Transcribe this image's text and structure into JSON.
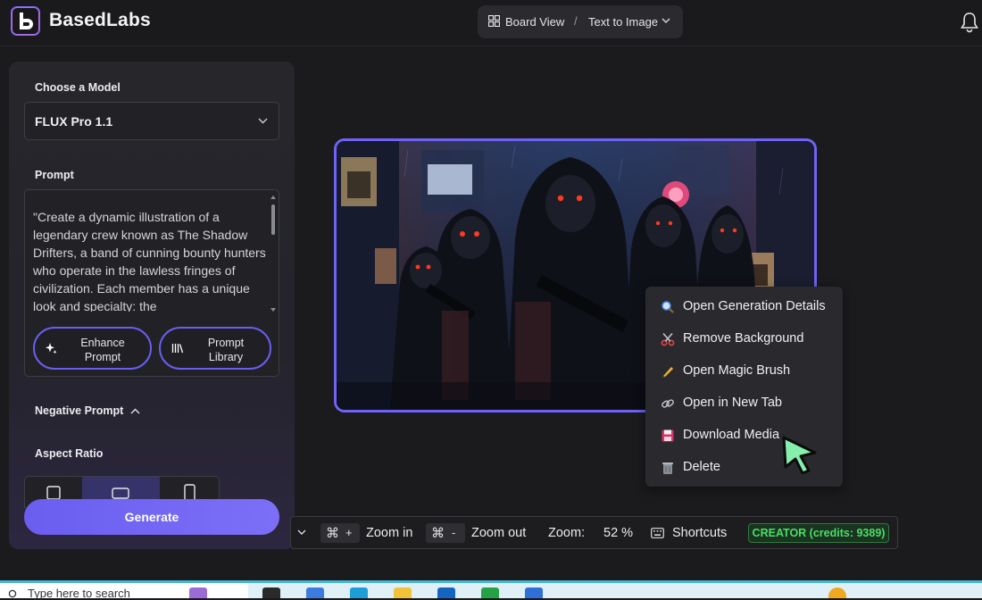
{
  "header": {
    "app_name": "BasedLabs",
    "breadcrumb_view": "Board View",
    "breadcrumb_separator": "/",
    "breadcrumb_mode": "Text to Image"
  },
  "sidebar": {
    "model_label": "Choose a Model",
    "model_value": "FLUX Pro 1.1",
    "prompt_label": "Prompt",
    "prompt_text": "\"Create a dynamic illustration of a legendary crew known as The Shadow Drifters, a band of cunning bounty hunters who operate in the lawless fringes of civilization. Each member has a unique look and specialty: the",
    "enhance_label_1": "Enhance",
    "enhance_label_2": "Prompt",
    "library_label_1": "Prompt",
    "library_label_2": "Library",
    "negative_prompt_label": "Negative Prompt",
    "aspect_ratio_label": "Aspect Ratio",
    "generate_label": "Generate"
  },
  "context_menu": {
    "items": [
      {
        "label": "Open Generation Details",
        "icon": "search-icon"
      },
      {
        "label": "Remove Background",
        "icon": "scissors-icon"
      },
      {
        "label": "Open Magic Brush",
        "icon": "pencil-icon"
      },
      {
        "label": "Open in New Tab",
        "icon": "link-icon"
      },
      {
        "label": "Download Media",
        "icon": "floppy-icon"
      },
      {
        "label": "Delete",
        "icon": "trash-icon"
      }
    ]
  },
  "bottombar": {
    "zoom_in_key_a": "⌘",
    "zoom_in_key_b": "+",
    "zoom_in_label": "Zoom in",
    "zoom_out_key_a": "⌘",
    "zoom_out_key_b": "-",
    "zoom_out_label": "Zoom out",
    "zoom_label": "Zoom:",
    "zoom_value": "52 %",
    "shortcuts_label": "Shortcuts",
    "creator_badge": "CREATOR (credits: 9389)"
  },
  "taskbar": {
    "search_placeholder": "Type here to search"
  },
  "colors": {
    "accent": "#6a5ef0",
    "credits_green": "#4ade66",
    "cursor_green": "#86efac"
  }
}
